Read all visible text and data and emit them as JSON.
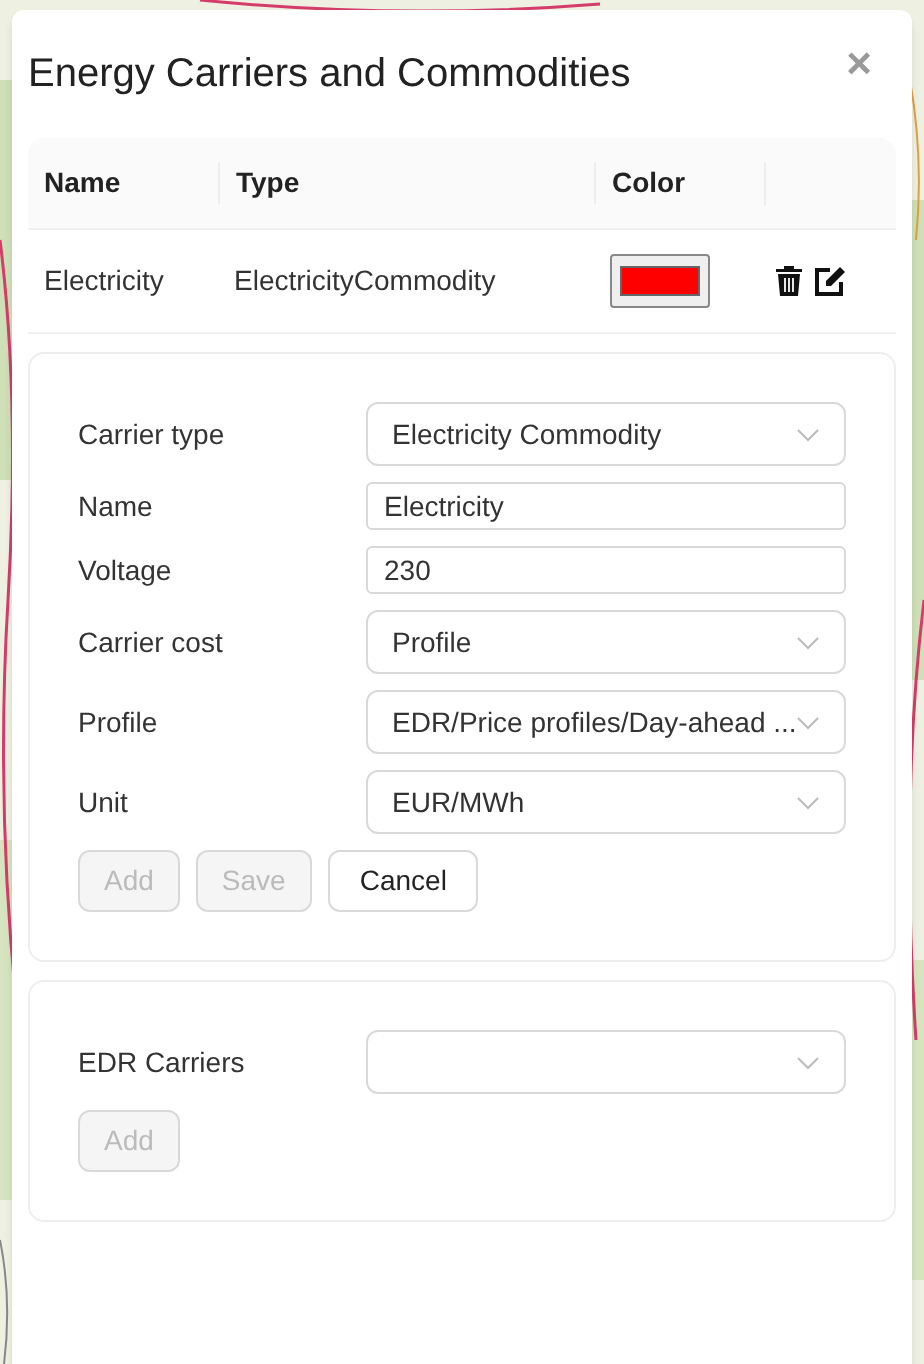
{
  "dialog": {
    "title": "Energy Carriers and Commodities",
    "close": "×"
  },
  "table": {
    "columns": [
      "Name",
      "Type",
      "Color"
    ],
    "rows": [
      {
        "name": "Electricity",
        "type": "ElectricityCommodity",
        "color": "#ff0000"
      }
    ]
  },
  "form": {
    "fields": [
      {
        "kind": "select",
        "label": "Carrier type",
        "value": "Electricity Commodity"
      },
      {
        "kind": "input",
        "label": "Name",
        "value": "Electricity"
      },
      {
        "kind": "input",
        "label": "Voltage",
        "value": "230"
      },
      {
        "kind": "select",
        "label": "Carrier cost",
        "value": "Profile"
      },
      {
        "kind": "select",
        "label": "Profile",
        "value": "EDR/Price profiles/Day-ahead ..."
      },
      {
        "kind": "select",
        "label": "Unit",
        "value": "EUR/MWh"
      }
    ],
    "buttons": [
      {
        "label": "Add",
        "disabled": true
      },
      {
        "label": "Save",
        "disabled": true
      },
      {
        "label": "Cancel",
        "disabled": false
      }
    ]
  },
  "edr": {
    "fields": [
      {
        "kind": "select",
        "label": "EDR Carriers"
      }
    ],
    "buttons": [
      {
        "label": "Add",
        "disabled": true
      }
    ]
  }
}
